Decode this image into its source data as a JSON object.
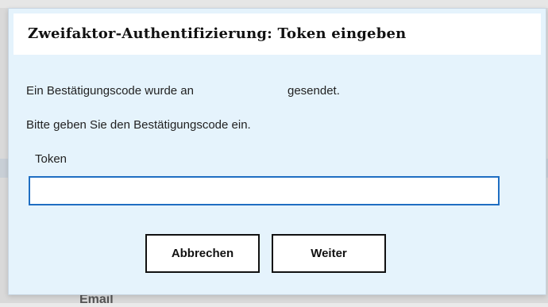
{
  "background": {
    "label": "Email"
  },
  "dialog": {
    "title": "Zweifaktor-Authentifizierung: Token eingeben",
    "message_part1": "Ein Bestätigungscode wurde an",
    "message_part2": "gesendet.",
    "instruction": "Bitte geben Sie den Bestätigungscode ein.",
    "token_label": "Token",
    "token_value": "",
    "cancel_label": "Abbrechen",
    "continue_label": "Weiter"
  },
  "colors": {
    "dialog_background": "#e5f3fc",
    "input_border": "#1f6ec2"
  }
}
